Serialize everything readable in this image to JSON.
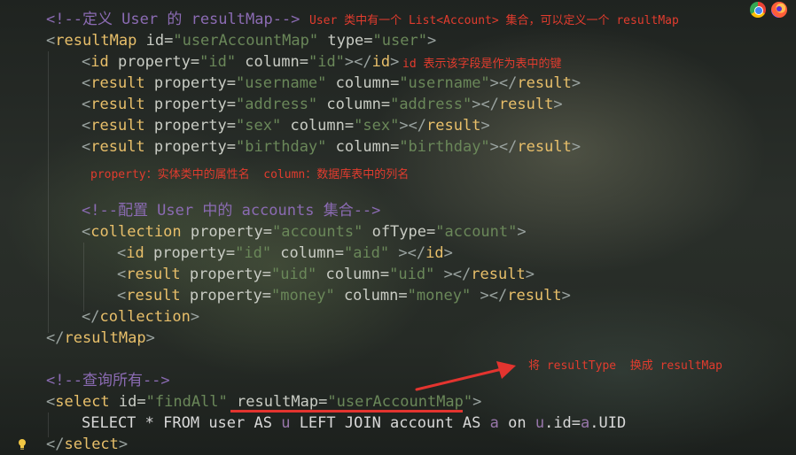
{
  "code": {
    "l1_comment": "<!--定义 User 的 resultMap-->",
    "l2": {
      "open": "<",
      "tag": "resultMap",
      "attr1": " id",
      "eq1": "=",
      "val1": "\"userAccountMap\"",
      "attr2": " type",
      "eq2": "=",
      "val2": "\"user\"",
      "close": ">"
    },
    "l3": {
      "open": "<",
      "tag": "id",
      "attr1": " property",
      "eq1": "=",
      "val1": "\"id\"",
      "attr2": " column",
      "eq2": "=",
      "val2": "\"id\"",
      "mid": "></",
      "tag2": "id",
      "close": ">"
    },
    "l4": {
      "open": "<",
      "tag": "result",
      "attr1": " property",
      "eq1": "=",
      "val1": "\"username\"",
      "attr2": " column",
      "eq2": "=",
      "val2": "\"username\"",
      "mid": "></",
      "tag2": "result",
      "close": ">"
    },
    "l5": {
      "open": "<",
      "tag": "result",
      "attr1": " property",
      "eq1": "=",
      "val1": "\"address\"",
      "attr2": " column",
      "eq2": "=",
      "val2": "\"address\"",
      "mid": "></",
      "tag2": "result",
      "close": ">"
    },
    "l6": {
      "open": "<",
      "tag": "result",
      "attr1": " property",
      "eq1": "=",
      "val1": "\"sex\"",
      "attr2": " column",
      "eq2": "=",
      "val2": "\"sex\"",
      "mid": "></",
      "tag2": "result",
      "close": ">"
    },
    "l7": {
      "open": "<",
      "tag": "result",
      "attr1": " property",
      "eq1": "=",
      "val1": "\"birthday\"",
      "attr2": " column",
      "eq2": "=",
      "val2": "\"birthday\"",
      "mid": "></",
      "tag2": "result",
      "close": ">"
    },
    "l9_comment": "<!--配置 User 中的 accounts 集合-->",
    "l10": {
      "open": "<",
      "tag": "collection",
      "attr1": " property",
      "eq1": "=",
      "val1": "\"accounts\"",
      "attr2": " ofType",
      "eq2": "=",
      "val2": "\"account\"",
      "close": ">"
    },
    "l11": {
      "open": "<",
      "tag": "id",
      "attr1": " property",
      "eq1": "=",
      "val1": "\"id\"",
      "attr2": " column",
      "eq2": "=",
      "val2": "\"aid\"",
      "mid": " ></",
      "tag2": "id",
      "close": ">"
    },
    "l12": {
      "open": "<",
      "tag": "result",
      "attr1": " property",
      "eq1": "=",
      "val1": "\"uid\"",
      "attr2": " column",
      "eq2": "=",
      "val2": "\"uid\"",
      "mid": " ></",
      "tag2": "result",
      "close": ">"
    },
    "l13": {
      "open": "<",
      "tag": "result",
      "attr1": " property",
      "eq1": "=",
      "val1": "\"money\"",
      "attr2": " column",
      "eq2": "=",
      "val2": "\"money\"",
      "mid": " ></",
      "tag2": "result",
      "close": ">"
    },
    "l14": {
      "open": "</",
      "tag": "collection",
      "close": ">"
    },
    "l15": {
      "open": "</",
      "tag": "resultMap",
      "close": ">"
    },
    "l17_comment": "<!--查询所有-->",
    "l18": {
      "open": "<",
      "tag": "select",
      "attr1": " id",
      "eq1": "=",
      "val1": "\"findAll\"",
      "attr2": " resultMap",
      "eq2": "=",
      "val2": "\"userAccountMap\"",
      "close": ">"
    },
    "l19": {
      "p1": "SELECT ",
      "p2": "*",
      "p3": " FROM user AS ",
      "p4": "u",
      "p5": " LEFT JOIN account AS ",
      "p6": "a",
      "p7": " on ",
      "p8": "u",
      "p9": ".id=",
      "p10": "a",
      "p11": ".UID"
    },
    "l20": {
      "open": "</",
      "tag": "select",
      "close": ">"
    }
  },
  "annotations": {
    "a1": "User 类中有一个 List<Account> 集合，可以定义一个 resultMap",
    "a2": "id 表示该字段是作为表中的键",
    "a3": "property：实体类中的属性名  column：数据库表中的列名",
    "a4": "将 resultType  换成 resultMap"
  },
  "colors": {
    "comment": "#8b6bb3",
    "tag": "#e8bf6a",
    "value": "#6a8759",
    "annotation": "#e23c2e",
    "underline": "#e3342f"
  },
  "icons": [
    "chrome-icon",
    "firefox-icon",
    "lightbulb-icon",
    "arrow-icon"
  ]
}
